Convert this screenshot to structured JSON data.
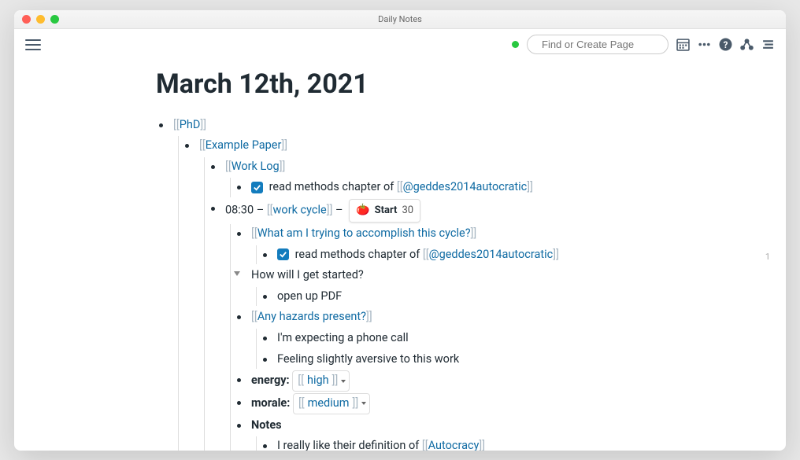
{
  "window_title": "Daily Notes",
  "search_placeholder": "Find or Create Page",
  "page_title": "March 12th, 2021",
  "links": {
    "phd": "PhD",
    "example_paper": "Example Paper",
    "work_log": "Work Log",
    "geddes": "@geddes2014autocratic",
    "work_cycle": "work cycle",
    "accomplish": "What am I trying to accomplish this cycle?",
    "hazards": "Any hazards present?",
    "high": "high",
    "medium": "medium",
    "autocracy": "Autocracy"
  },
  "text": {
    "read_methods": "read methods chapter of ",
    "time": "08:30",
    "dash": " – ",
    "how_started": "How will I get started?",
    "open_pdf": "open up PDF",
    "phone_call": "I'm expecting a phone call",
    "aversive": "Feeling slightly aversive to this work",
    "energy_label": "energy: ",
    "morale_label": "morale: ",
    "notes_label": "Notes",
    "definition": "I really like their definition of "
  },
  "pomo": {
    "emoji": "🍅",
    "label": "Start",
    "minutes": "30"
  },
  "ref_count": "1"
}
